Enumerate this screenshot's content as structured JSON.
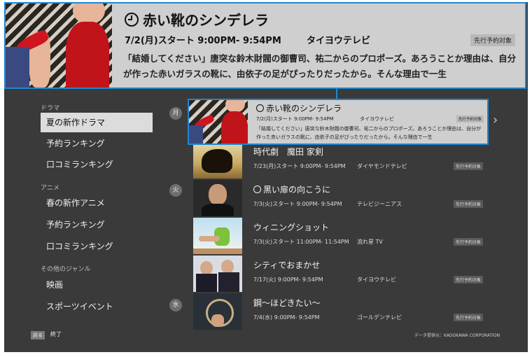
{
  "detail": {
    "title": "赤い靴のシンデレラ",
    "schedule": "7/2(月)スタート 9:00PM- 9:54PM",
    "channel": "タイヨウテレビ",
    "badge": "先行予約対象",
    "description": "「結婚してください」唐突な鈴木財閥の御曹司、祐二からのプロポーズ。あろうことか理由は、自分が作った赤いガラスの靴に、由依子の足がぴったりだったから。そんな理由で一生"
  },
  "sidebar": {
    "categories": [
      {
        "heading": "ドラマ",
        "items": [
          "夏の新作ドラマ",
          "予約ランキング",
          "口コミランキング"
        ]
      },
      {
        "heading": "アニメ",
        "items": [
          "春の新作アニメ",
          "予約ランキング",
          "口コミランキング"
        ]
      },
      {
        "heading": "その他のジャンル",
        "items": [
          "映画",
          "スポーツイベント"
        ]
      }
    ]
  },
  "days": [
    "月",
    "火",
    "水"
  ],
  "selected": {
    "title": "赤い靴のシンデレラ",
    "schedule": "7/2(月)スタート 9:00PM- 9:54PM",
    "channel": "タイヨウテレビ",
    "badge": "先行予約対象",
    "description": "「結婚してください」唐突な鈴木財閥の御曹司、祐二からのプロポーズ。あろうことか理由は、自分が作った赤いガラスの靴に、由依子の足がぴったりだったから。そんな理由で一生"
  },
  "programs": [
    {
      "title": "時代劇　魔田 家剣",
      "schedule": "7/23(月)スタート 9:00PM- 9:54PM",
      "channel": "ダイヤモンドテレビ",
      "badge": "先行予約対象"
    },
    {
      "title": "黒い扉の向こうに",
      "schedule": "7/3(火)スタート 9:00PM- 9:54PM",
      "channel": "テレビジーニアス",
      "badge": "先行予約対象"
    },
    {
      "title": "ウィニングショット",
      "schedule": "7/3(火)スタート 11:00PM- 11:54PM",
      "channel": "流れ星 TV",
      "badge": "先行予約対象"
    },
    {
      "title": "シティでおまかせ",
      "schedule": "7/17(火) 9:00PM- 9:54PM",
      "channel": "タイヨウテレビ",
      "badge": "先行予約対象"
    },
    {
      "title": "鋼～ほどきたい～",
      "schedule": "7/4(水) 9:00PM- 9:54PM",
      "channel": "ゴールデンテレビ",
      "badge": "先行予約対象"
    }
  ],
  "footer": {
    "back_key": "戻る",
    "back_label": "終了",
    "credit": "データ提供元：KADOKAWA CORPORATION"
  },
  "colors": {
    "accent": "#1e88d4",
    "background": "#3a3a3a",
    "panel": "#cfcfcf"
  }
}
